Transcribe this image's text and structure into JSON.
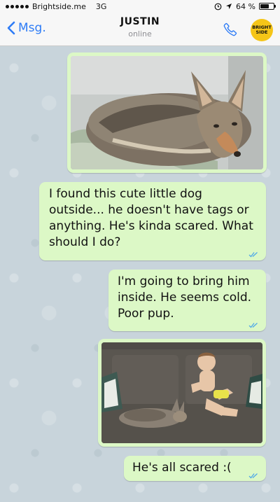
{
  "status_bar": {
    "carrier": "Brightside.me",
    "network": "3G",
    "battery": "64 %",
    "battery_level": 0.64
  },
  "header": {
    "back_label": "Msg.",
    "contact_name": "JUSTIN",
    "contact_status": "online",
    "brand_badge": "BRIGHT SIDE"
  },
  "messages": [
    {
      "type": "image",
      "direction": "outgoing",
      "image": "coyote-on-blanket"
    },
    {
      "type": "text",
      "direction": "outgoing",
      "text": "I found this cute little dog outside... he doesn't have tags or anything. He's kinda scared. What should I do?"
    },
    {
      "type": "text",
      "direction": "outgoing",
      "text": "I'm going to bring him inside. He seems cold. Poor pup."
    },
    {
      "type": "image",
      "direction": "outgoing",
      "image": "coyote-and-boy-on-sofa"
    },
    {
      "type": "text",
      "direction": "outgoing",
      "text": "He's all scared :("
    }
  ],
  "colors": {
    "bubble": "#dcf8c6",
    "accent": "#2e7cf6",
    "read_ticks": "#4fa8e8",
    "badge": "#f5c518"
  }
}
